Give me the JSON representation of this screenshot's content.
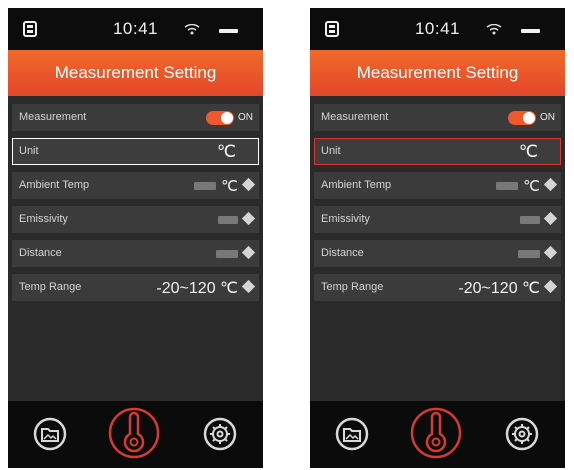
{
  "status": {
    "time": "10:41"
  },
  "header": {
    "title": "Measurement Setting"
  },
  "settings": {
    "measurement": {
      "label": "Measurement",
      "toggle": "ON"
    },
    "unit": {
      "label": "Unit",
      "value": "℃"
    },
    "ambient_temp": {
      "label": "Ambient Temp",
      "unit": "℃"
    },
    "emissivity": {
      "label": "Emissivity"
    },
    "distance": {
      "label": "Distance"
    },
    "temp_range": {
      "label": "Temp Range",
      "value": "-20~120 ℃"
    }
  },
  "nav": {
    "left_icon": "folder-image-icon",
    "center_icon": "thermometer-icon",
    "right_icon": "gear-icon"
  },
  "colors": {
    "accent": "#ee5a2e",
    "selected_border_left": "#ffffff",
    "selected_border_right": "#d63a33",
    "panel": "#2a2a2a",
    "row": "#3b3b3b"
  }
}
